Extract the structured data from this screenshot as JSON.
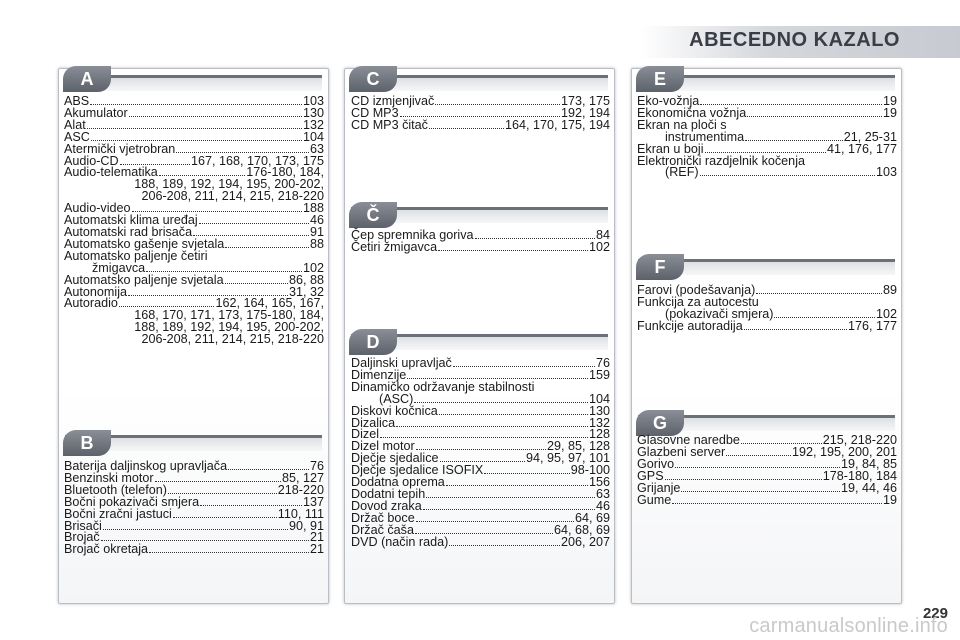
{
  "page_title": "ABECEDNO KAZALO",
  "page_number": "229",
  "watermark": "carmanualsonline.info",
  "sections": {
    "A": {
      "letter": "A",
      "entries": [
        {
          "label": "ABS",
          "pages": "103"
        },
        {
          "label": "Akumulator",
          "pages": "130"
        },
        {
          "label": "Alat",
          "pages": "132"
        },
        {
          "label": "ASC",
          "pages": "104"
        },
        {
          "label": "Atermički vjetrobran",
          "pages": "63"
        },
        {
          "label": "Audio-CD",
          "pages": "167, 168, 170, 173, 175"
        },
        {
          "label": "Audio-telematika",
          "pages": "176-180, 184,"
        },
        {
          "cont": "188, 189, 192, 194, 195, 200-202,"
        },
        {
          "cont": "206-208, 211, 214, 215, 218-220"
        },
        {
          "label": "Audio-video",
          "pages": "188"
        },
        {
          "label": "Automatski klima uređaj",
          "pages": "46"
        },
        {
          "label": "Automatski rad brisača",
          "pages": "91"
        },
        {
          "label": "Automatsko gašenje svjetala",
          "pages": "88"
        },
        {
          "label": "Automatsko paljenje četiri",
          "plain": true
        },
        {
          "label": "žmigavca",
          "pages": "102",
          "sub": true
        },
        {
          "label": "Automatsko paljenje svjetala",
          "pages": "86, 88"
        },
        {
          "label": "Autonomija",
          "pages": "31, 32"
        },
        {
          "label": "Autoradio",
          "pages": "162, 164, 165, 167,"
        },
        {
          "cont": "168, 170, 171, 173, 175-180, 184,"
        },
        {
          "cont": "188, 189, 192, 194, 195, 200-202,"
        },
        {
          "cont": "206-208, 211, 214, 215, 218-220"
        }
      ]
    },
    "B": {
      "letter": "B",
      "entries": [
        {
          "label": "Baterija daljinskog upravljača",
          "pages": "76"
        },
        {
          "label": "Benzinski motor",
          "pages": "85, 127"
        },
        {
          "label": "Bluetooth (telefon)",
          "pages": "218-220"
        },
        {
          "label": "Bočni pokazivači smjera",
          "pages": "137"
        },
        {
          "label": "Bočni zračni jastuci",
          "pages": "110, 111"
        },
        {
          "label": "Brisači",
          "pages": "90, 91"
        },
        {
          "label": "Brojač",
          "pages": "21"
        },
        {
          "label": "Brojač okretaja",
          "pages": "21"
        }
      ]
    },
    "C": {
      "letter": "C",
      "entries": [
        {
          "label": "CD izmjenjivač",
          "pages": "173, 175"
        },
        {
          "label": "CD MP3",
          "pages": "192, 194"
        },
        {
          "label": "CD MP3 čitač",
          "pages": "164, 170, 175, 194"
        }
      ]
    },
    "CC": {
      "letter": "Č",
      "entries": [
        {
          "label": "Čep spremnika goriva",
          "pages": "84"
        },
        {
          "label": "Četiri žmigavca",
          "pages": "102"
        }
      ]
    },
    "D": {
      "letter": "D",
      "entries": [
        {
          "label": "Daljinski upravljač",
          "pages": "76"
        },
        {
          "label": "Dimenzije",
          "pages": "159"
        },
        {
          "label": "Dinamičko održavanje stabilnosti",
          "plain": true
        },
        {
          "label": "(ASC)",
          "pages": "104",
          "sub": true
        },
        {
          "label": "Diskovi kočnica",
          "pages": "130"
        },
        {
          "label": "Dizalica",
          "pages": "132"
        },
        {
          "label": "Dizel",
          "pages": "128"
        },
        {
          "label": "Dizel motor",
          "pages": "29, 85, 128"
        },
        {
          "label": "Dječje sjedalice",
          "pages": "94, 95, 97, 101"
        },
        {
          "label": "Dječje sjedalice ISOFIX",
          "pages": "98-100"
        },
        {
          "label": "Dodatna oprema",
          "pages": "156"
        },
        {
          "label": "Dodatni tepih",
          "pages": "63"
        },
        {
          "label": "Dovod zraka",
          "pages": "46"
        },
        {
          "label": "Držač boce",
          "pages": "64, 69"
        },
        {
          "label": "Držač čaša",
          "pages": "64, 68, 69"
        },
        {
          "label": "DVD (način rada)",
          "pages": "206, 207"
        }
      ]
    },
    "E": {
      "letter": "E",
      "entries": [
        {
          "label": "Eko-vožnja",
          "pages": "19"
        },
        {
          "label": "Ekonomična vožnja",
          "pages": "19"
        },
        {
          "label": "Ekran na ploči s",
          "plain": true
        },
        {
          "label": "instrumentima",
          "pages": "21, 25-31",
          "sub": true
        },
        {
          "label": "Ekran u boji",
          "pages": "41, 176, 177"
        },
        {
          "label": "Elektronički razdjelnik kočenja",
          "plain": true
        },
        {
          "label": "(REF)",
          "pages": "103",
          "sub": true
        }
      ]
    },
    "F": {
      "letter": "F",
      "entries": [
        {
          "label": "Farovi (podešavanja)",
          "pages": "89"
        },
        {
          "label": "Funkcija za autocestu",
          "plain": true
        },
        {
          "label": "(pokazivači smjera)",
          "pages": "102",
          "sub": true
        },
        {
          "label": "Funkcije autoradija",
          "pages": "176, 177"
        }
      ]
    },
    "G": {
      "letter": "G",
      "entries": [
        {
          "label": "Glasovne naredbe",
          "pages": "215, 218-220"
        },
        {
          "label": "Glazbeni server",
          "pages": "192, 195, 200, 201"
        },
        {
          "label": "Gorivo",
          "pages": "19, 84, 85"
        },
        {
          "label": "GPS",
          "pages": "178-180, 184"
        },
        {
          "label": "Grijanje",
          "pages": "19, 44, 46"
        },
        {
          "label": "Gume",
          "pages": "19"
        }
      ]
    }
  }
}
